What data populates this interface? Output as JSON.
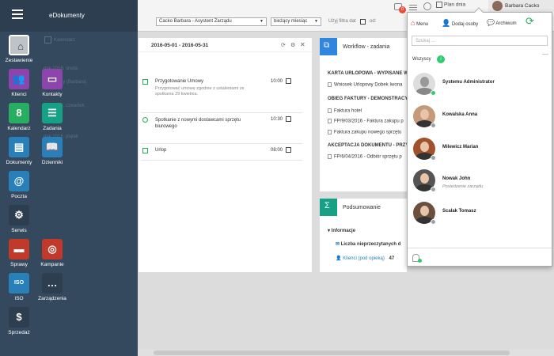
{
  "app": {
    "title": "eDokumenty"
  },
  "sidebar": {
    "tiles": [
      {
        "label": "Zestawienie",
        "icon": "home-icon",
        "color": "#ffffff"
      },
      {
        "label": "Klienci",
        "icon": "clients-icon",
        "color": "#8e44ad"
      },
      {
        "label": "Kontakty",
        "icon": "contacts-icon",
        "color": "#8e44ad"
      },
      {
        "label": "Kalendarz",
        "icon": "calendar-icon",
        "color": "#27ae60"
      },
      {
        "label": "Zadania",
        "icon": "tasks-icon",
        "color": "#16a085"
      },
      {
        "label": "Dokumenty",
        "icon": "documents-icon",
        "color": "#2980b9"
      },
      {
        "label": "Dzienniki",
        "icon": "journal-icon",
        "color": "#2980b9"
      },
      {
        "label": "Poczta",
        "icon": "mail-icon",
        "color": "#2980b9"
      },
      {
        "label": "Serwis",
        "icon": "gears-icon",
        "color": "#2c3e50"
      },
      {
        "label": "Sprawy",
        "icon": "briefcase-icon",
        "color": "#c0392b"
      },
      {
        "label": "Kampanie",
        "icon": "target-icon",
        "color": "#c0392b"
      },
      {
        "label": "ISO",
        "icon": "iso-icon",
        "color": "#2980b9"
      },
      {
        "label": "Zarządzenia",
        "icon": "chat-icon",
        "color": "#2c3e50"
      },
      {
        "label": "Sprzedaż",
        "icon": "sales-icon",
        "color": "#2c3e50"
      }
    ],
    "dimmed": [
      {
        "text": "Kalendarz"
      },
      {
        "text": "maj 2016, środa"
      },
      {
        "text": "sesja rady (Barbara)"
      },
      {
        "text": "maj 2016, czwartek"
      },
      {
        "text": "maj 2016, piątek"
      }
    ]
  },
  "topbar": {
    "notification_count": "0",
    "plan_label": "Plan dnia",
    "user_name": "Barbara Cacko",
    "user_select": "Cacko Barbara - Asystent Zarządu",
    "period_select": "bieżący miesiąc",
    "filter_label": "Użyj filtra dat",
    "from_label": "od:"
  },
  "agenda": {
    "date_range": "2016-05-01 - 2016-05-31",
    "items": [
      {
        "title": "Przygotowanie Umowy",
        "note": "Przygotować umowę zgodnie z ustaleniami ze spotkania 29 kwietnia.",
        "time": "10:00"
      },
      {
        "title": "Spotkanie z nowymi dostawcami sprzętu biurowego",
        "note": "",
        "time": "10:30"
      },
      {
        "title": "Urlop",
        "note": "",
        "time": "08:00"
      }
    ]
  },
  "workflow": {
    "title": "Workflow - zadania",
    "rows": [
      {
        "type": "head",
        "text": "KARTA URLOPOWA - WYPISANE W"
      },
      {
        "type": "doc",
        "text": "Wniosek Urlopowy Dobek Iwona"
      },
      {
        "type": "head",
        "text": "OBIEG FAKTURY - DEMONSTRACY"
      },
      {
        "type": "doc",
        "text": "Faktura hotel"
      },
      {
        "type": "doc",
        "text": "FP/9/03/2016 - Faktura zakupu p"
      },
      {
        "type": "doc",
        "text": "Faktura zakupu nowego sprzętu"
      },
      {
        "type": "head",
        "text": "AKCEPTACJA DOKUMENTU - PRZY"
      },
      {
        "type": "doc",
        "text": "FP/6/04/2016 - Odbiór sprzętu p"
      }
    ]
  },
  "summary": {
    "title": "Podsumowanie",
    "section": "Informacje",
    "unread_label": "Liczba nieprzeczytanych d",
    "clients_label": "Klienci (pod opieką)",
    "clients_count": "47"
  },
  "popup": {
    "menu_label": "Menu",
    "add_label": "Dodaj osoby",
    "archive_label": "Archiwum",
    "search_placeholder": "Szukaj ...",
    "group_label": "Wszyscy",
    "group_count": "i",
    "people": [
      {
        "name": "Systemu Administrator",
        "position": "",
        "status": "#2ecc71"
      },
      {
        "name": "Kowalska Anna",
        "position": "",
        "status": "#95a5a6"
      },
      {
        "name": "Milewicz Marian",
        "position": "",
        "status": "#95a5a6"
      },
      {
        "name": "Nowak John",
        "position": "Posiedzenie zarządu",
        "status": "#95a5a6"
      },
      {
        "name": "Scalak Tomasz",
        "position": "",
        "status": "#95a5a6"
      }
    ]
  }
}
